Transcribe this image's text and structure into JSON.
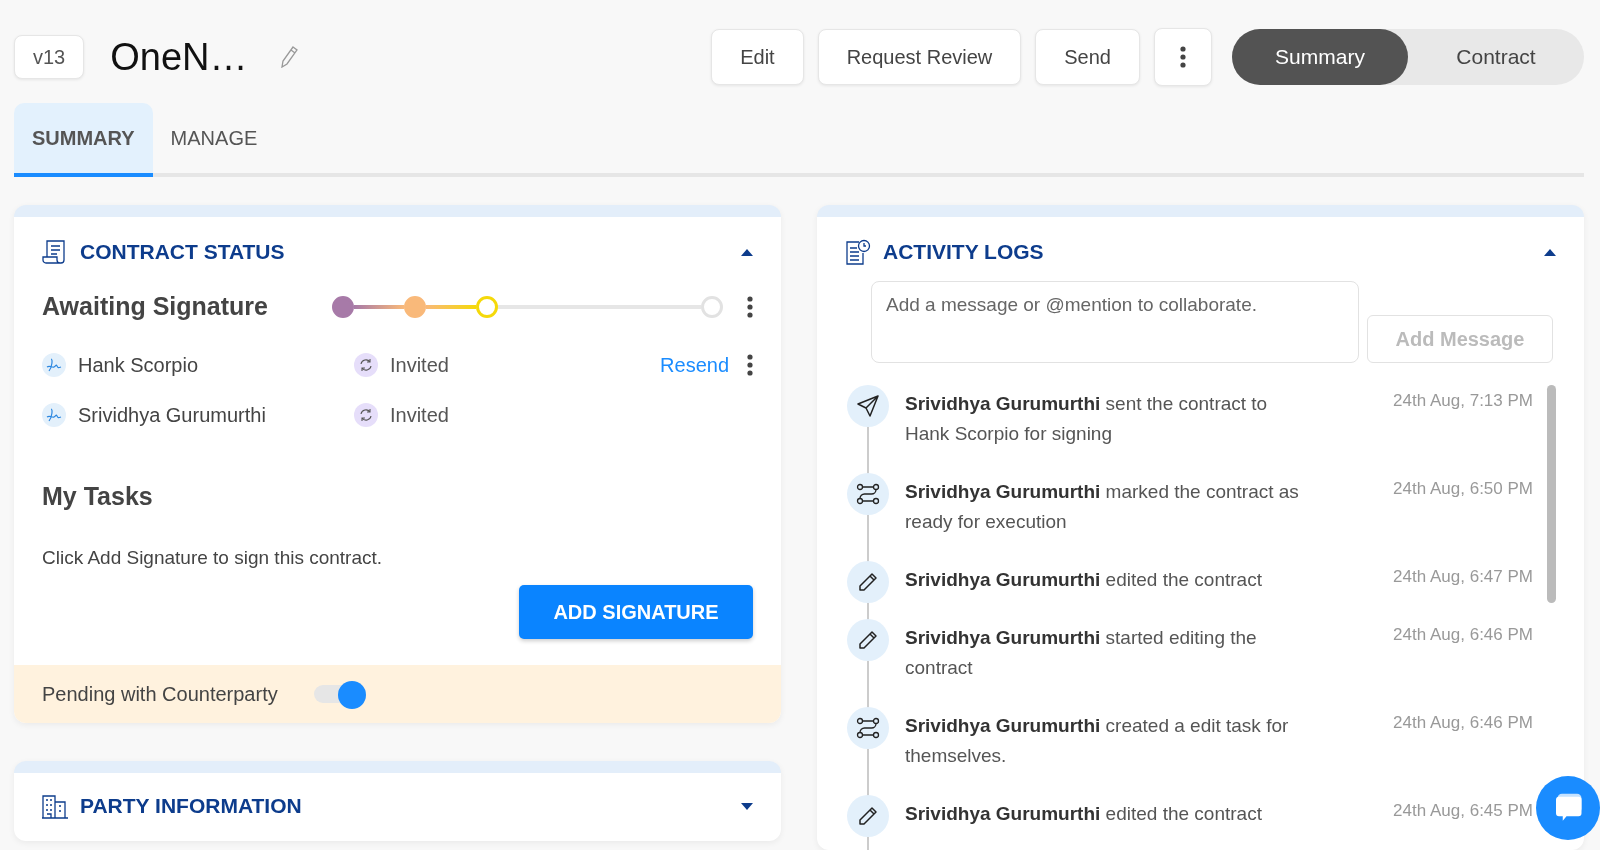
{
  "header": {
    "version": "v13",
    "title": "OneN…",
    "buttons": [
      "Edit",
      "Request Review",
      "Send"
    ],
    "views": [
      {
        "label": "Summary",
        "selected": true
      },
      {
        "label": "Contract",
        "selected": false
      }
    ]
  },
  "tabs": [
    {
      "label": "SUMMARY",
      "selected": true
    },
    {
      "label": "MANAGE",
      "selected": false
    }
  ],
  "contract_status": {
    "title": "CONTRACT STATUS",
    "expanded": true,
    "status": "Awaiting Signature",
    "steps": [
      {
        "kind": "done",
        "color": "#a77aa8"
      },
      {
        "kind": "done",
        "color": "#f9b97a"
      },
      {
        "kind": "current",
        "color": "#f5d90a"
      },
      {
        "kind": "pending",
        "color": "#e2e2e2"
      }
    ],
    "signers": [
      {
        "name": "Hank Scorpio",
        "status": "Invited",
        "action": "Resend"
      },
      {
        "name": "Srividhya Gurumurthi",
        "status": "Invited"
      }
    ],
    "tasks_title": "My Tasks",
    "task_text": "Click Add Signature to sign this contract.",
    "task_button": "ADD SIGNATURE",
    "pending": {
      "label": "Pending with Counterparty",
      "on": true
    }
  },
  "party_information": {
    "title": "PARTY INFORMATION",
    "expanded": false
  },
  "activity_logs": {
    "title": "ACTIVITY LOGS",
    "expanded": true,
    "placeholder": "Add a message or @mention to collaborate.",
    "button": "Add Message",
    "entries": [
      {
        "kind": "send",
        "text": "**Srividhya Gurumurthi** sent the contract to Hank Scorpio for signing",
        "time": "24th Aug, 7:13 PM"
      },
      {
        "kind": "workflow",
        "text": "**Srividhya Gurumurthi** marked the contract as ready for execution",
        "time": "24th Aug, 6:50 PM"
      },
      {
        "kind": "edit",
        "text": "**Srividhya Gurumurthi** edited the contract",
        "time": "24th Aug, 6:47 PM"
      },
      {
        "kind": "edit",
        "text": "**Srividhya Gurumurthi** started editing the contract",
        "time": "24th Aug, 6:46 PM"
      },
      {
        "kind": "workflow",
        "text": "**Srividhya Gurumurthi** created a edit task for themselves.",
        "time": "24th Aug, 6:46 PM"
      },
      {
        "kind": "edit",
        "text": "**Srividhya Gurumurthi** edited the contract",
        "time": "24th Aug, 6:45 PM"
      }
    ]
  }
}
